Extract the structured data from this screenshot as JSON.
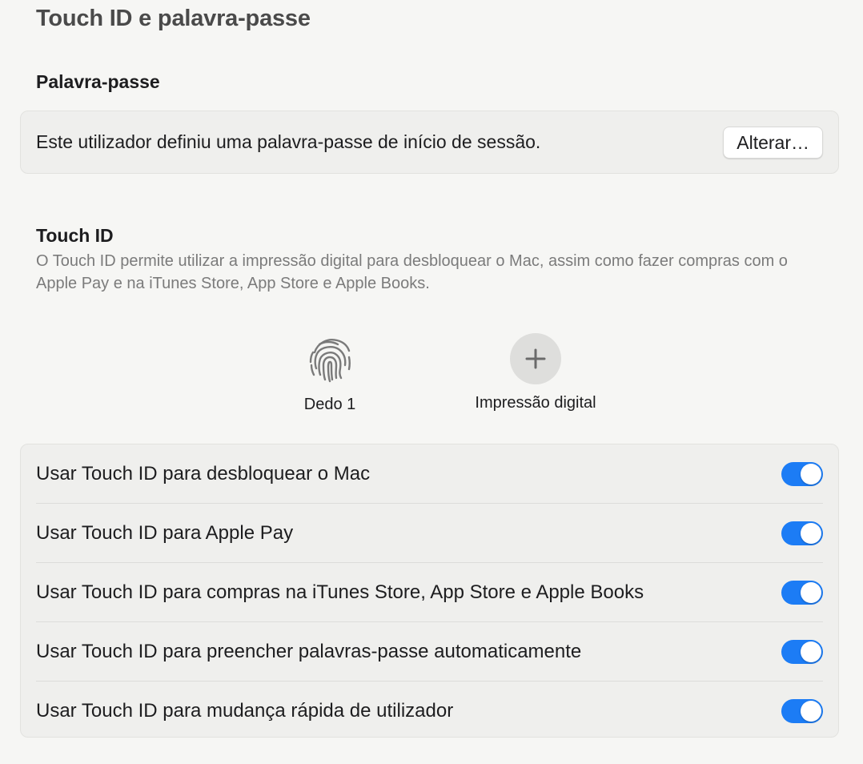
{
  "window": {
    "title": "Touch ID e palavra-passe"
  },
  "password_section": {
    "heading": "Palavra-passe",
    "status_text": "Este utilizador definiu uma palavra-passe de início de sessão.",
    "change_button_label": "Alterar…"
  },
  "touchid_section": {
    "heading": "Touch ID",
    "description": "O Touch ID permite utilizar a impressão digital para desbloquear o Mac, assim como fazer compras com o Apple Pay e na iTunes Store, App Store e Apple Books.",
    "fingerprints": [
      {
        "label": "Dedo 1",
        "icon": "fingerprint-icon"
      }
    ],
    "add_fingerprint": {
      "label": "Impressão digital",
      "icon": "plus-icon"
    }
  },
  "toggles": [
    {
      "label": "Usar Touch ID para desbloquear o Mac",
      "enabled": true
    },
    {
      "label": "Usar Touch ID para Apple Pay",
      "enabled": true
    },
    {
      "label": "Usar Touch ID para compras na iTunes Store, App Store e Apple Books",
      "enabled": true
    },
    {
      "label": "Usar Touch ID para preencher palavras-passe automaticamente",
      "enabled": true
    },
    {
      "label": "Usar Touch ID para mudança rápida de utilizador",
      "enabled": true
    }
  ],
  "colors": {
    "accent": "#1c7cf5",
    "background": "#f6f6f4",
    "card": "#efefed"
  }
}
